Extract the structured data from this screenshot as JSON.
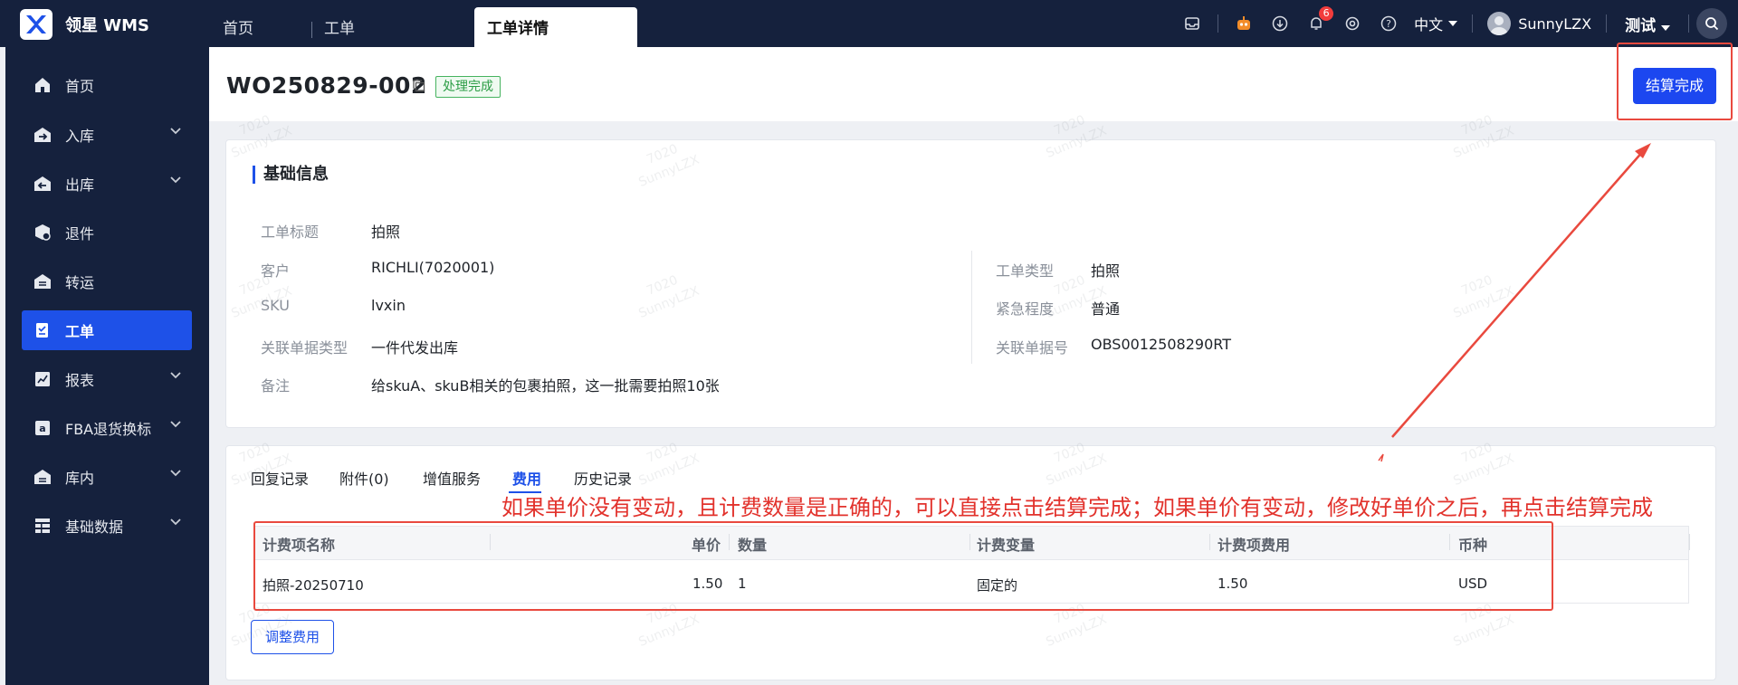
{
  "brand": {
    "name": "领星 WMS"
  },
  "top_tabs": [
    {
      "label": "首页"
    },
    {
      "label": "工单"
    },
    {
      "label": "工单详情"
    }
  ],
  "top_right": {
    "notification_count": "6",
    "language": "中文",
    "username": "SunnyLZX",
    "env_label": "测试"
  },
  "sidebar": {
    "items": [
      {
        "label": "首页"
      },
      {
        "label": "入库"
      },
      {
        "label": "出库"
      },
      {
        "label": "退件"
      },
      {
        "label": "转运"
      },
      {
        "label": "工单"
      },
      {
        "label": "报表"
      },
      {
        "label": "FBA退货换标"
      },
      {
        "label": "库内"
      },
      {
        "label": "基础数据"
      }
    ]
  },
  "header": {
    "work_order_no": "WO250829-002",
    "status": "处理完成",
    "settle_button": "结算完成"
  },
  "basic_info": {
    "title": "基础信息",
    "fields_left": [
      {
        "label": "工单标题",
        "value": "拍照"
      },
      {
        "label": "客户",
        "value": "RICHLI(7020001)"
      },
      {
        "label": "SKU",
        "value": "lvxin"
      },
      {
        "label": "关联单据类型",
        "value": "一件代发出库"
      },
      {
        "label": "备注",
        "value": "给skuA、skuB相关的包裹拍照，这一批需要拍照10张"
      }
    ],
    "fields_right": [
      {
        "label": "工单类型",
        "value": "拍照"
      },
      {
        "label": "紧急程度",
        "value": "普通"
      },
      {
        "label": "关联单据号",
        "value": "OBS0012508290RT"
      }
    ]
  },
  "detail_tabs": [
    {
      "label": "回复记录"
    },
    {
      "label": "附件(0)"
    },
    {
      "label": "增值服务"
    },
    {
      "label": "费用"
    },
    {
      "label": "历史记录"
    }
  ],
  "annotation": "如果单价没有变动，且计费数量是正确的，可以直接点击结算完成；如果单价有变动，修改好单价之后，再点击结算完成",
  "fee_table": {
    "headers": [
      "计费项名称",
      "单价",
      "数量",
      "计费变量",
      "计费项费用",
      "币种"
    ],
    "rows": [
      [
        "拍照-20250710",
        "1.50",
        "1",
        "固定的",
        "1.50",
        "USD"
      ]
    ]
  },
  "adjust_button": "调整费用",
  "watermark": [
    "7020",
    "SunnyLZX"
  ],
  "colors": {
    "nav_bg": "#15213d",
    "primary": "#1e51e8",
    "status_green": "#2b9d45",
    "annotation_red": "#e2322c"
  }
}
